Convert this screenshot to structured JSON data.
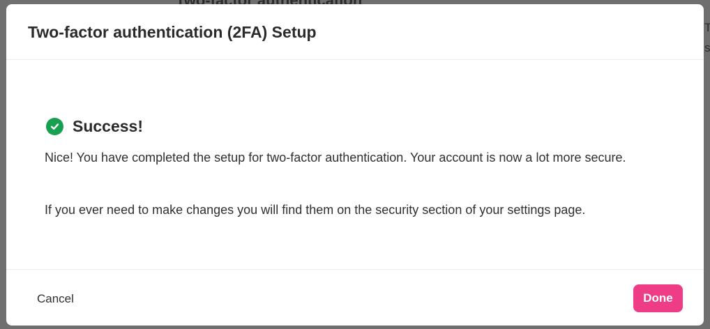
{
  "background": {
    "heading": "Two-factor authentication",
    "text_line_1": "T",
    "text_line_2": "ss"
  },
  "modal": {
    "title": "Two-factor authentication (2FA) Setup",
    "success": {
      "icon": "check-circle-icon",
      "title": "Success!",
      "paragraph_1": "Nice! You have completed the setup for two-factor authentication. Your account is now a lot more secure.",
      "paragraph_2": "If you ever need to make changes you will find them on the security section of your settings page."
    },
    "footer": {
      "cancel_label": "Cancel",
      "done_label": "Done"
    }
  },
  "colors": {
    "accent": "#ee3d86",
    "success": "#17a04f",
    "overlay": "#6f6f6f"
  }
}
